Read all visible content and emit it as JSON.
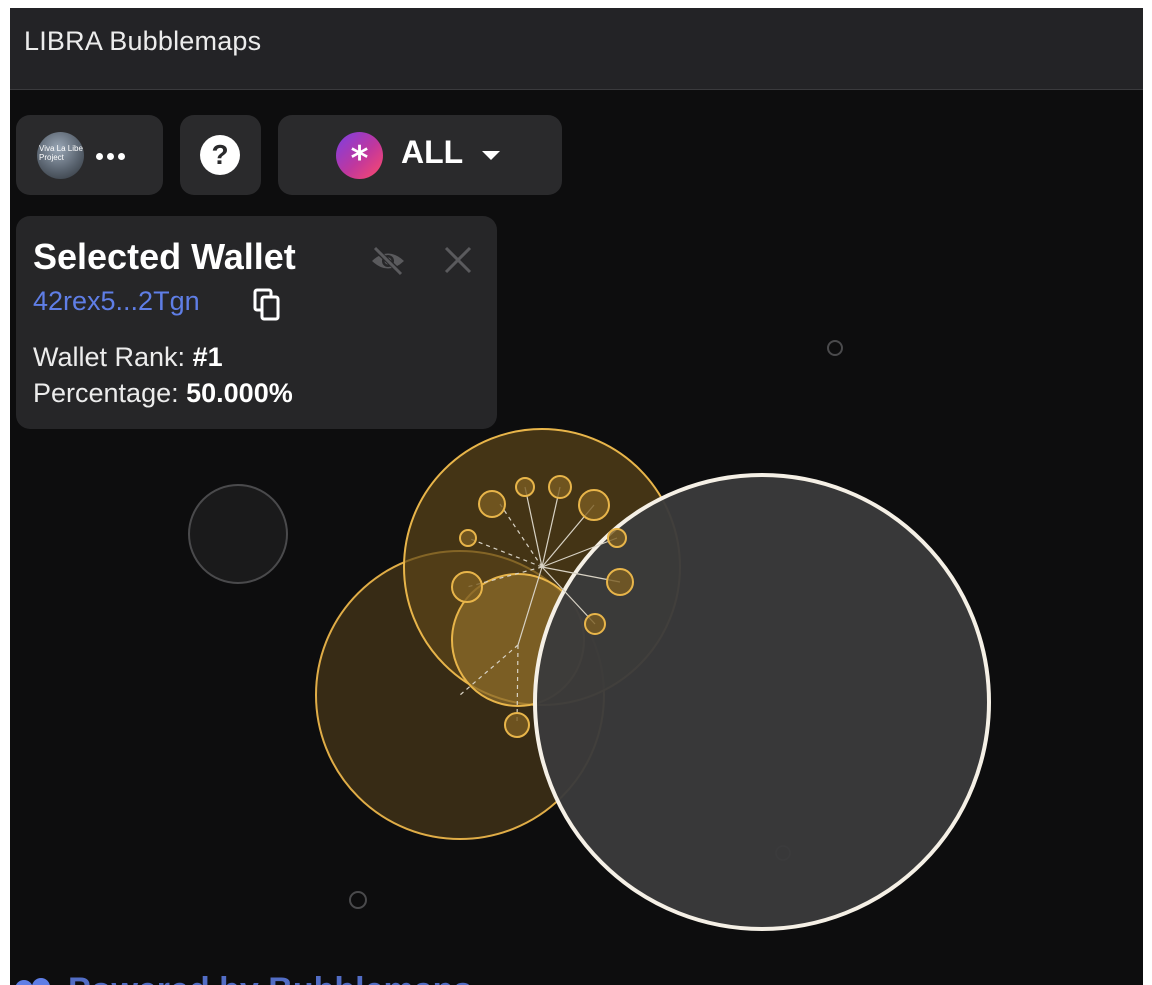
{
  "app": {
    "title": "LIBRA Bubblemaps"
  },
  "toolbar": {
    "project_avatar_text": "Viva La Libe Project",
    "more_icon": "more-horizontal-icon",
    "help_icon": "help-circle-icon",
    "help_glyph": "?",
    "filter_icon": "asterisk-icon",
    "filter_glyph": "*",
    "filter_label": "ALL",
    "filter_caret_icon": "caret-down-icon"
  },
  "selected_wallet": {
    "title": "Selected Wallet",
    "address": "42rex5...2Tgn",
    "rank_label": "Wallet Rank:",
    "rank_value": "#1",
    "percentage_label": "Percentage:",
    "percentage_value": "50.000%",
    "hide_icon": "eye-off-icon",
    "close_icon": "close-icon",
    "copy_icon": "copy-icon"
  },
  "footer": {
    "text": "Powered by Bubblemaps"
  },
  "colors": {
    "background": "#0d0d0e",
    "titlebar": "#232326",
    "panel": "#262628",
    "accent_link": "#5f7ee6",
    "cluster_gold": "#e8b54a",
    "selected_bubble": "#3a3a3b",
    "selected_border": "#ffffff"
  }
}
